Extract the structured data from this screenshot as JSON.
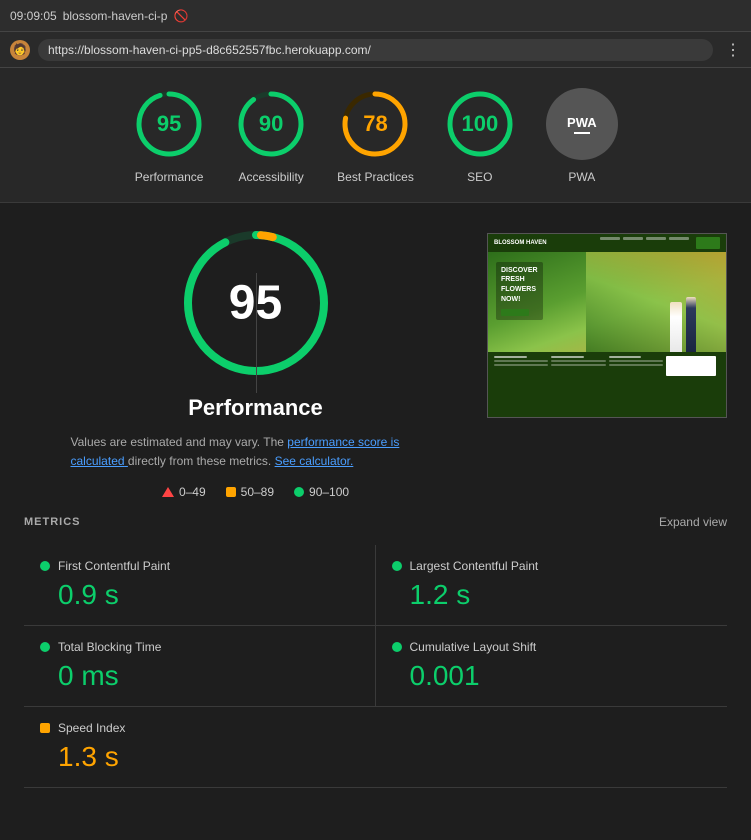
{
  "browser": {
    "time": "09:09:05",
    "title": "blossom-haven-ci-p",
    "url": "https://blossom-haven-ci-pp5-d8c652557fbc.herokuapp.com/",
    "menu_icon": "⋮"
  },
  "scores": [
    {
      "id": "performance",
      "label": "Performance",
      "value": 95,
      "color": "#0cce6b",
      "bg_color": "#0cce6b",
      "track_color": "#1a3a2a"
    },
    {
      "id": "accessibility",
      "label": "Accessibility",
      "value": 90,
      "color": "#0cce6b",
      "bg_color": "#0cce6b",
      "track_color": "#1a3a2a"
    },
    {
      "id": "best-practices",
      "label": "Best Practices",
      "value": 78,
      "color": "#ffa400",
      "bg_color": "#ffa400",
      "track_color": "#3a2800"
    },
    {
      "id": "seo",
      "label": "SEO",
      "value": 100,
      "color": "#0cce6b",
      "bg_color": "#0cce6b",
      "track_color": "#1a3a2a"
    },
    {
      "id": "pwa",
      "label": "PWA",
      "value": null,
      "color": "#888",
      "bg_color": "#888"
    }
  ],
  "performance": {
    "big_score": 95,
    "title": "Performance",
    "description": "Values are estimated and may vary. The",
    "link1_text": "performance score is calculated",
    "link2_text": "See calculator.",
    "description_middle": "directly from these metrics.",
    "legend": [
      {
        "type": "triangle",
        "color": "#f44336",
        "label": "0–49"
      },
      {
        "type": "square",
        "color": "#ffa400",
        "label": "50–89"
      },
      {
        "type": "circle",
        "color": "#0cce6b",
        "label": "90–100"
      }
    ]
  },
  "metrics_header": {
    "title": "METRICS",
    "expand_label": "Expand view"
  },
  "metrics": [
    {
      "id": "fcp",
      "name": "First Contentful Paint",
      "value": "0.9 s",
      "dot_color": "#0cce6b",
      "value_color": "green"
    },
    {
      "id": "lcp",
      "name": "Largest Contentful Paint",
      "value": "1.2 s",
      "dot_color": "#0cce6b",
      "value_color": "green"
    },
    {
      "id": "tbt",
      "name": "Total Blocking Time",
      "value": "0 ms",
      "dot_color": "#0cce6b",
      "value_color": "green"
    },
    {
      "id": "cls",
      "name": "Cumulative Layout Shift",
      "value": "0.001",
      "dot_color": "#0cce6b",
      "value_color": "green"
    }
  ],
  "speed_index": {
    "name": "Speed Index",
    "value": "1.3 s",
    "dot_color": "#ffa400",
    "value_color": "orange"
  }
}
